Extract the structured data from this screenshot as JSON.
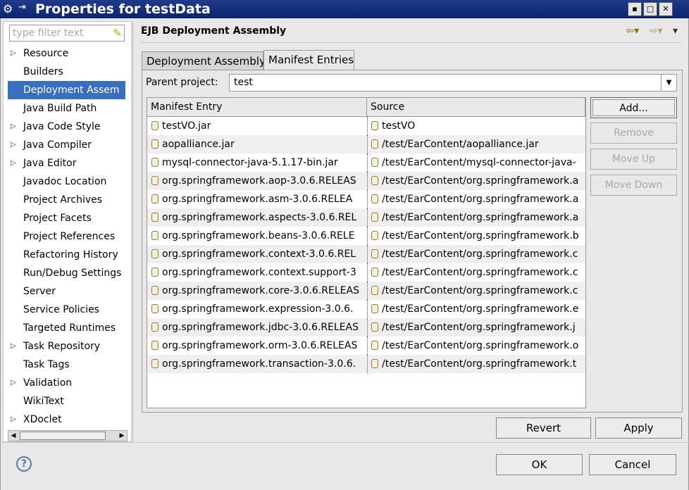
{
  "window": {
    "title": "Properties for testData"
  },
  "filter": {
    "placeholder": "type filter text"
  },
  "tree": [
    {
      "label": "Resource",
      "expandable": true
    },
    {
      "label": "Builders",
      "expandable": false
    },
    {
      "label": "Deployment Assem",
      "expandable": false,
      "selected": true
    },
    {
      "label": "Java Build Path",
      "expandable": false
    },
    {
      "label": "Java Code Style",
      "expandable": true
    },
    {
      "label": "Java Compiler",
      "expandable": true
    },
    {
      "label": "Java Editor",
      "expandable": true
    },
    {
      "label": "Javadoc Location",
      "expandable": false
    },
    {
      "label": "Project Archives",
      "expandable": false
    },
    {
      "label": "Project Facets",
      "expandable": false
    },
    {
      "label": "Project References",
      "expandable": false
    },
    {
      "label": "Refactoring History",
      "expandable": false
    },
    {
      "label": "Run/Debug Settings",
      "expandable": false
    },
    {
      "label": "Server",
      "expandable": false
    },
    {
      "label": "Service Policies",
      "expandable": false
    },
    {
      "label": "Targeted Runtimes",
      "expandable": false
    },
    {
      "label": "Task Repository",
      "expandable": true
    },
    {
      "label": "Task Tags",
      "expandable": false
    },
    {
      "label": "Validation",
      "expandable": true
    },
    {
      "label": "WikiText",
      "expandable": false
    },
    {
      "label": "XDoclet",
      "expandable": true
    }
  ],
  "page": {
    "title": "EJB Deployment Assembly"
  },
  "tabs": [
    {
      "label": "Deployment Assembly",
      "active": false
    },
    {
      "label": "Manifest Entries",
      "active": true
    }
  ],
  "parent": {
    "label": "Parent project:",
    "value": "test"
  },
  "table": {
    "columns": [
      "Manifest Entry",
      "Source"
    ],
    "rows": [
      [
        "testVO.jar",
        "testVO"
      ],
      [
        "aopalliance.jar",
        "/test/EarContent/aopalliance.jar"
      ],
      [
        "mysql-connector-java-5.1.17-bin.jar",
        "/test/EarContent/mysql-connector-java-"
      ],
      [
        "org.springframework.aop-3.0.6.RELEAS",
        "/test/EarContent/org.springframework.a"
      ],
      [
        "org.springframework.asm-3.0.6.RELEA",
        "/test/EarContent/org.springframework.a"
      ],
      [
        "org.springframework.aspects-3.0.6.REL",
        "/test/EarContent/org.springframework.a"
      ],
      [
        "org.springframework.beans-3.0.6.RELE",
        "/test/EarContent/org.springframework.b"
      ],
      [
        "org.springframework.context-3.0.6.REL",
        "/test/EarContent/org.springframework.c"
      ],
      [
        "org.springframework.context.support-3",
        "/test/EarContent/org.springframework.c"
      ],
      [
        "org.springframework.core-3.0.6.RELEAS",
        "/test/EarContent/org.springframework.c"
      ],
      [
        "org.springframework.expression-3.0.6.",
        "/test/EarContent/org.springframework.e"
      ],
      [
        "org.springframework.jdbc-3.0.6.RELEAS",
        "/test/EarContent/org.springframework.j"
      ],
      [
        "org.springframework.orm-3.0.6.RELEAS",
        "/test/EarContent/org.springframework.o"
      ],
      [
        "org.springframework.transaction-3.0.6.",
        "/test/EarContent/org.springframework.t"
      ]
    ]
  },
  "side_buttons": {
    "add": "Add...",
    "remove": "Remove",
    "move_up": "Move Up",
    "move_down": "Move Down"
  },
  "buttons": {
    "revert": "Revert",
    "apply": "Apply",
    "ok": "OK",
    "cancel": "Cancel"
  },
  "icons": {
    "help": "?",
    "system_menu": "gear-icon",
    "jar": "jar-icon"
  }
}
